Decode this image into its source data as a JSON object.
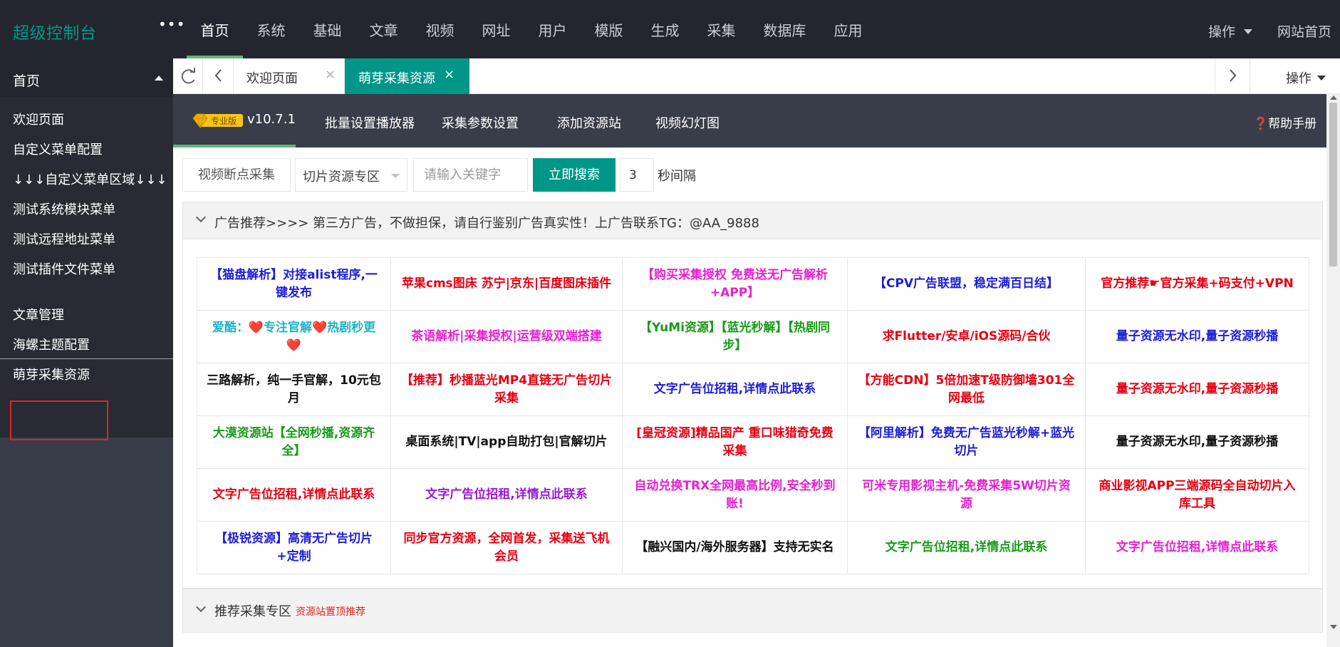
{
  "header": {
    "logo": "超级控制台",
    "more": "•••",
    "nav": [
      "首页",
      "系统",
      "基础",
      "文章",
      "视频",
      "网址",
      "用户",
      "模版",
      "生成",
      "采集",
      "数据库",
      "应用"
    ],
    "active_nav": "首页",
    "operations": "操作",
    "site_home": "网站首页"
  },
  "sidebar": {
    "head": "首页",
    "items": [
      "欢迎页面",
      "自定义菜单配置",
      "↓↓↓自定义菜单区域↓↓↓",
      "测试系统模块菜单",
      "测试远程地址菜单",
      "测试插件文件菜单"
    ],
    "items2": [
      "文章管理",
      "海螺主题配置",
      "萌芽采集资源"
    ],
    "selected": "萌芽采集资源"
  },
  "tabs": {
    "items": [
      {
        "label": "欢迎页面",
        "active": false
      },
      {
        "label": "萌芽采集资源",
        "active": true
      }
    ],
    "close_glyph": "×",
    "operations": "操作"
  },
  "subnav": {
    "badge": "专业版",
    "version": "v10.7.1",
    "items": [
      "批量设置播放器",
      "采集参数设置",
      "添加资源站",
      "视频幻灯图"
    ],
    "help": "❓帮助手册"
  },
  "toolbar": {
    "video_button": "视频断点采集",
    "select_value": "切片资源专区",
    "keyword_placeholder": "请输入关键字",
    "search_button": "立即搜索",
    "interval_value": "3",
    "interval_label": "秒间隔"
  },
  "ad_panel": {
    "title": "广告推荐>>>>  第三方广告，不做担保，请自行鉴别广告真实性！上广告联系TG：@AA_9888",
    "rows": [
      [
        {
          "text": "【猫盘解析】对接alist程序,一键发布",
          "color": "#1e1ed6"
        },
        {
          "text": "苹果cms图床 苏宁|京东|百度图床插件",
          "color": "#e60012"
        },
        {
          "text": "【购买采集授权 免费送无广告解析+APP】",
          "color": "#e620d3"
        },
        {
          "text": "【CPV广告联盟，稳定满百日结】",
          "color": "#1e1ed6"
        },
        {
          "text": "官方推荐☛官方采集+码支付+VPN",
          "color": "#e60012"
        }
      ],
      [
        {
          "text": "爱酷：❤️专注官解❤️热剧秒更❤️",
          "color": "#1fb3c7"
        },
        {
          "text": "茶语解析|采集授权|运营级双端搭建",
          "color": "#e620d3"
        },
        {
          "text": "【YuMi资源】【蓝光秒解】【热剧同步】",
          "color": "#1a9a1a"
        },
        {
          "text": "求Flutter/安卓/iOS源码/合伙",
          "color": "#e60012"
        },
        {
          "text": "量子资源无水印,量子资源秒播",
          "color": "#1e1ed6"
        }
      ],
      [
        {
          "text": "三路解析，纯一手官解，10元包月",
          "color": "#111111"
        },
        {
          "text": "【推荐】秒播蓝光MP4直链无广告切片采集",
          "color": "#e60012"
        },
        {
          "text": "文字广告位招租,详情点此联系",
          "color": "#1e1ed6"
        },
        {
          "text": "【方能CDN】5倍加速T级防御墙301全网最低",
          "color": "#e60012"
        },
        {
          "text": "量子资源无水印,量子资源秒播",
          "color": "#e60012"
        }
      ],
      [
        {
          "text": "大漠资源站【全网秒播,资源齐全】",
          "color": "#1a9a1a"
        },
        {
          "text": "桌面系统|TV|app自助打包|官解切片",
          "color": "#111111"
        },
        {
          "text": "[皇冠资源]精品国产 重口味猎奇免费采集",
          "color": "#e60012"
        },
        {
          "text": "【阿里解析】免费无广告蓝光秒解+蓝光切片",
          "color": "#1e1ed6"
        },
        {
          "text": "量子资源无水印,量子资源秒播",
          "color": "#111111"
        }
      ],
      [
        {
          "text": "文字广告位招租,详情点此联系",
          "color": "#e60012"
        },
        {
          "text": "文字广告位招租,详情点此联系",
          "color": "#9a1ad6"
        },
        {
          "text": "自动兑换TRX全网最高比例,安全秒到账!",
          "color": "#e620d3"
        },
        {
          "text": "可米专用影视主机-免费采集5W切片资源",
          "color": "#e620d3"
        },
        {
          "text": "商业影视APP三端源码全自动切片入库工具",
          "color": "#e60012"
        }
      ],
      [
        {
          "text": "【极锐资源】高清无广告切片+定制",
          "color": "#1e1ed6"
        },
        {
          "text": "同步官方资源，全网首发，采集送飞机会员",
          "color": "#e60012"
        },
        {
          "text": "【融兴国内/海外服务器】支持无实名",
          "color": "#111111"
        },
        {
          "text": "文字广告位招租,详情点此联系",
          "color": "#1a9a1a"
        },
        {
          "text": "文字广告位招租,详情点此联系",
          "color": "#e620d3"
        }
      ]
    ]
  },
  "recommend_panel": {
    "title": "推荐采集专区",
    "tag": "资源站置顶推荐"
  },
  "colors": {
    "header_bg": "#23262e",
    "sidebar_bg": "#393d49",
    "accent": "#009688",
    "active_underline": "#5fb878"
  }
}
